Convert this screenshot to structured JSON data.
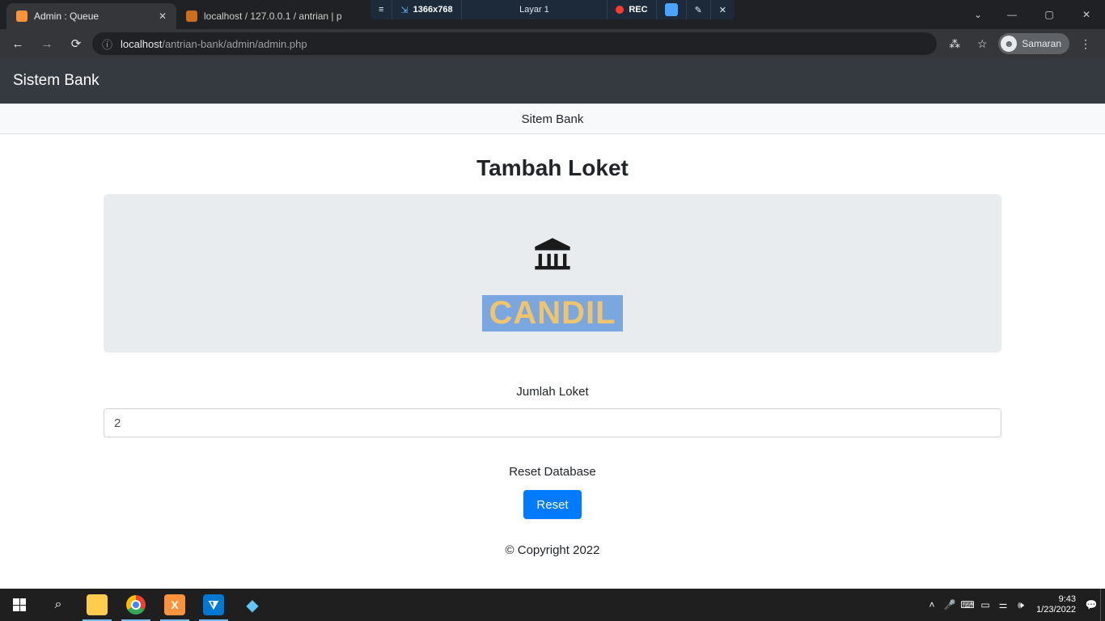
{
  "recorder": {
    "dimensions": "1366x768",
    "screen_label": "Layar 1",
    "rec_label": "REC"
  },
  "browser": {
    "tabs": [
      {
        "title": "Admin : Queue",
        "active": true
      },
      {
        "title": "localhost / 127.0.0.1 / antrian | p",
        "active": false
      }
    ],
    "url_prefix": "localhost",
    "url_path": "/antrian-bank/admin/admin.php",
    "profile_name": "Samaran"
  },
  "page": {
    "navbar_brand": "Sistem Bank",
    "subheader": "Sitem Bank",
    "heading": "Tambah Loket",
    "brand_highlight": "CANDIL",
    "form": {
      "jumlah_label": "Jumlah Loket",
      "jumlah_value": "2",
      "reset_label": "Reset Database",
      "reset_button": "Reset"
    },
    "copyright": "© Copyright 2022"
  },
  "taskbar": {
    "time": "9:43",
    "date": "1/23/2022"
  }
}
